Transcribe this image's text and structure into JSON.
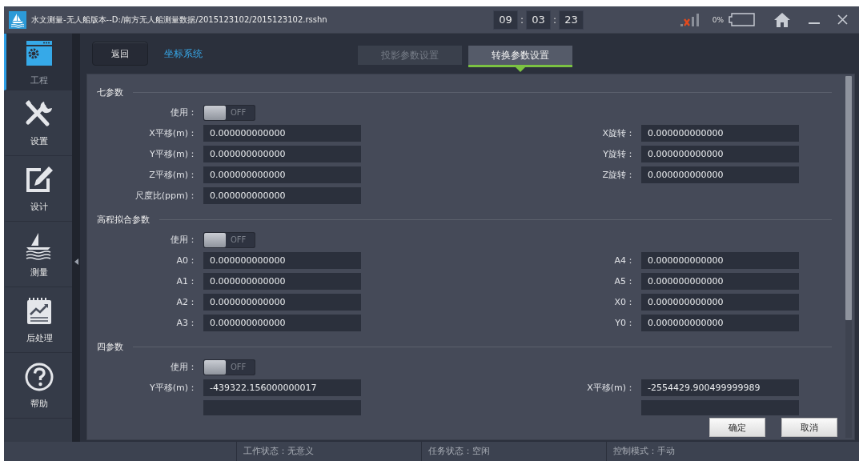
{
  "window": {
    "title": "水文测量-无人船版本--D:/南方无人船测量数据/2015123102/2015123102.rsshn",
    "clock": [
      {
        "kind": "digits",
        "text": "09"
      },
      {
        "kind": "sep",
        "text": ":"
      },
      {
        "kind": "digits",
        "text": "03"
      },
      {
        "kind": "sep",
        "text": ":"
      },
      {
        "kind": "digits",
        "text": "23"
      }
    ],
    "battery": "0%"
  },
  "sidebar": {
    "items": [
      {
        "label": "工程",
        "kind": "project",
        "selected": true
      },
      {
        "label": "设置",
        "kind": "tools",
        "selected": false
      },
      {
        "label": "设计",
        "kind": "edit",
        "selected": false
      },
      {
        "label": "测量",
        "kind": "boat",
        "selected": false
      },
      {
        "label": "后处理",
        "kind": "chart",
        "selected": false
      },
      {
        "label": "帮助",
        "kind": "help",
        "selected": false
      }
    ]
  },
  "header": {
    "back_button": "返回",
    "breadcrumb": "坐标系统",
    "tabs": [
      {
        "label": "投影参数设置",
        "selected": false
      },
      {
        "label": "转换参数设置",
        "selected": true
      }
    ]
  },
  "sections": [
    {
      "title": "七参数",
      "use_label": "使用：",
      "toggle": {
        "on": false,
        "text": "OFF"
      },
      "rows": [
        {
          "left": {
            "label": "X平移(m)：",
            "value": "0.000000000000"
          },
          "right": {
            "label": "X旋转：",
            "value": "0.000000000000"
          }
        },
        {
          "left": {
            "label": "Y平移(m)：",
            "value": "0.000000000000"
          },
          "right": {
            "label": "Y旋转：",
            "value": "0.000000000000"
          }
        },
        {
          "left": {
            "label": "Z平移(m)：",
            "value": "0.000000000000"
          },
          "right": {
            "label": "Z旋转：",
            "value": "0.000000000000"
          }
        },
        {
          "left": {
            "label": "尺度比(ppm)：",
            "value": "0.000000000000"
          }
        }
      ]
    },
    {
      "title": "高程拟合参数",
      "use_label": "使用：",
      "toggle": {
        "on": false,
        "text": "OFF"
      },
      "rows": [
        {
          "left": {
            "label": "A0：",
            "value": "0.000000000000"
          },
          "right": {
            "label": "A4：",
            "value": "0.000000000000"
          }
        },
        {
          "left": {
            "label": "A1：",
            "value": "0.000000000000"
          },
          "right": {
            "label": "A5：",
            "value": "0.000000000000"
          }
        },
        {
          "left": {
            "label": "A2：",
            "value": "0.000000000000"
          },
          "right": {
            "label": "X0：",
            "value": "0.000000000000"
          }
        },
        {
          "left": {
            "label": "A3：",
            "value": "0.000000000000"
          },
          "right": {
            "label": "Y0：",
            "value": "0.000000000000"
          }
        }
      ]
    },
    {
      "title": "四参数",
      "use_label": "使用：",
      "toggle": {
        "on": false,
        "text": "OFF"
      },
      "rows": [
        {
          "left": {
            "label": "Y平移(m)：",
            "value": "-439322.156000000017"
          },
          "right": {
            "label": "X平移(m)：",
            "value": "-2554429.900499999989"
          }
        },
        {
          "kind": "cut"
        }
      ]
    }
  ],
  "buttons": [
    {
      "label": "确定"
    },
    {
      "label": "取消"
    }
  ],
  "status_bar": [
    "工作状态：无意义",
    "任务状态：空闲",
    "控制模式：手动"
  ]
}
